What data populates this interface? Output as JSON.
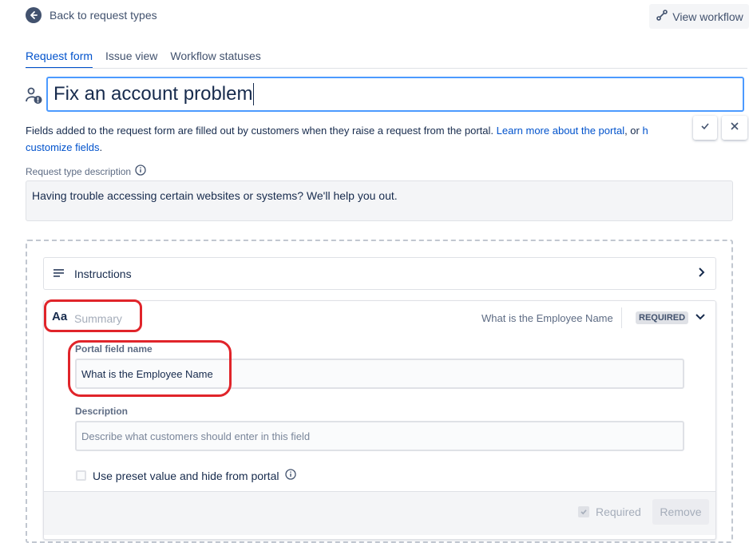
{
  "header": {
    "back_label": "Back to request types",
    "view_workflow_label": "View workflow"
  },
  "tabs": [
    {
      "label": "Request form",
      "active": true
    },
    {
      "label": "Issue view",
      "active": false
    },
    {
      "label": "Workflow statuses",
      "active": false
    }
  ],
  "request_type": {
    "name": "Fix an account problem"
  },
  "help": {
    "text": "Fields added to the request form are filled out by customers when they raise a request from the portal. ",
    "learn_more_link": "Learn more about the portal",
    "joiner": ", or ",
    "link_fragment": "h",
    "customize_link": "customize fields",
    "period": "."
  },
  "description": {
    "label": "Request type description",
    "value": "Having trouble accessing certain websites or systems? We'll help you out."
  },
  "instructions": {
    "label": "Instructions"
  },
  "field": {
    "type_icon_text": "Aa",
    "name_placeholder": "Summary",
    "portal_name_display": "What is the Employee Name",
    "required_badge": "REQUIRED",
    "portal_field_label": "Portal field name",
    "portal_field_value": "What is the Employee Name",
    "description_label": "Description",
    "description_placeholder": "Describe what customers should enter in this field",
    "preset_label": "Use preset value and hide from portal",
    "required_label": "Required",
    "remove_label": "Remove"
  },
  "colors": {
    "accent": "#0052cc",
    "focus_border": "#4c9aff",
    "annotation_red": "#e0242a"
  }
}
